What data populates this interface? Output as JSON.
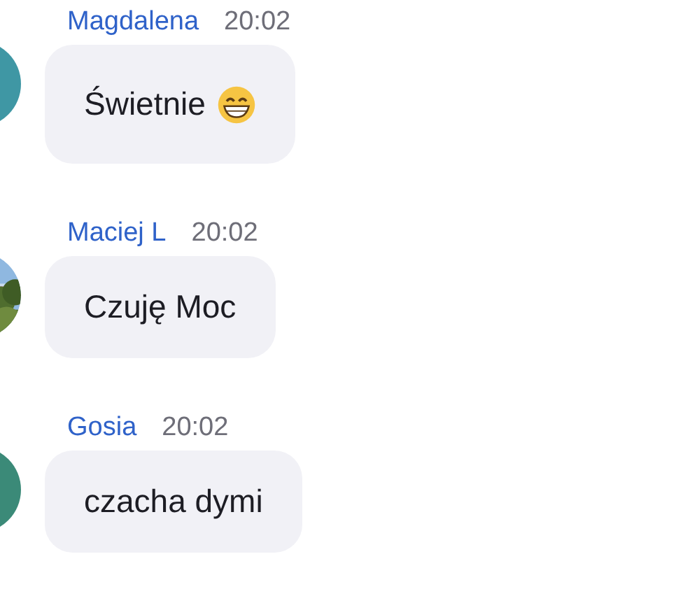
{
  "messages": [
    {
      "sender": "Magdalena",
      "time": "20:02",
      "text": "Świetnie",
      "emoji_icon": true,
      "avatar": {
        "kind": "color",
        "color": "#3f97a4"
      }
    },
    {
      "sender": "Maciej L",
      "time": "20:02",
      "text": "Czuję Moc",
      "emoji_icon": false
    },
    {
      "sender": "Gosia",
      "time": "20:02",
      "text": "czacha dymi",
      "emoji_icon": false,
      "avatar": {
        "kind": "color",
        "color": "#3b8a78"
      }
    }
  ]
}
